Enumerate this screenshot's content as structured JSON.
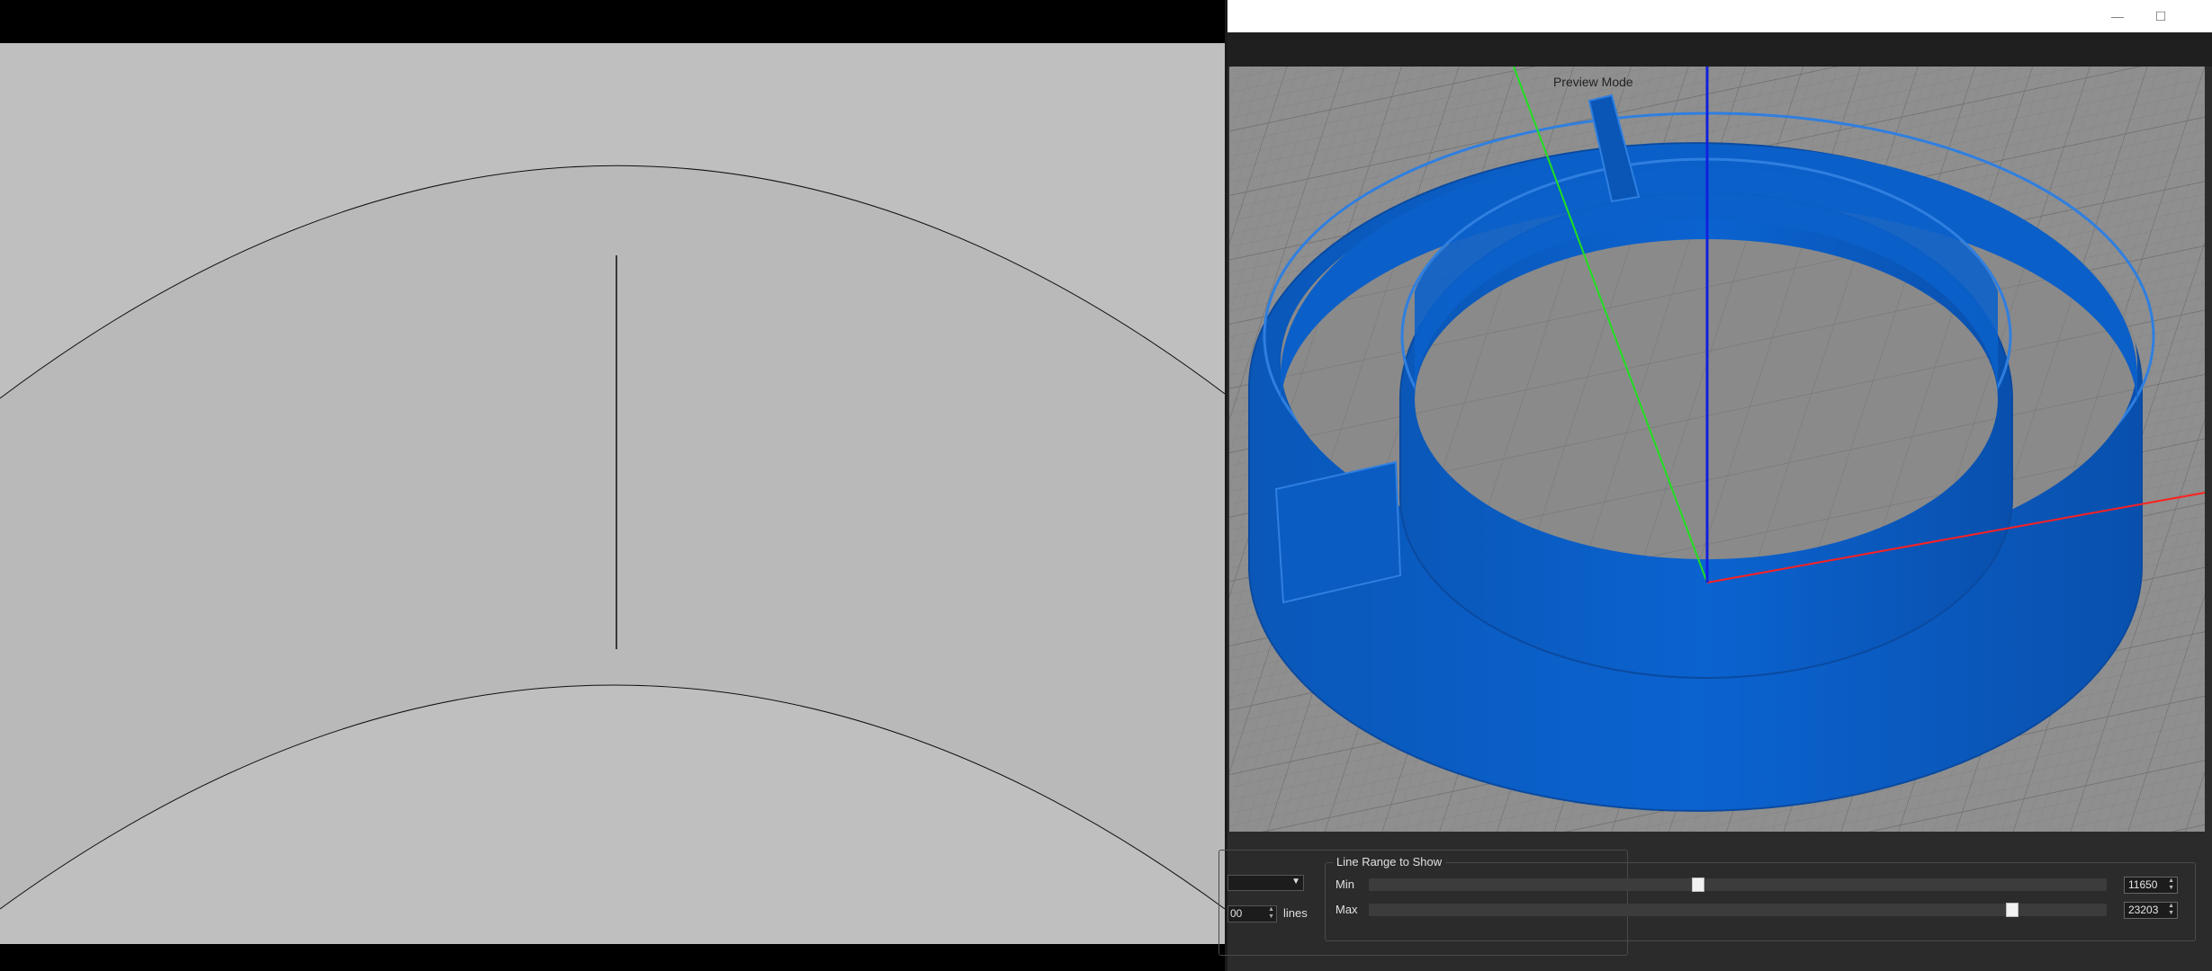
{
  "window": {
    "minimize_glyph": "—",
    "maximize_glyph": "☐"
  },
  "viewport": {
    "mode_label": "Preview Mode"
  },
  "left_controls": {
    "lines_value": "00",
    "lines_unit": "lines"
  },
  "line_range": {
    "title": "Line Range to Show",
    "min_label": "Min",
    "max_label": "Max",
    "min_value": "11650",
    "max_value": "23203",
    "min_fraction": 0.446,
    "max_fraction": 0.879
  },
  "colors": {
    "model": "#0a5fc7",
    "x_axis": "#ff2020",
    "y_axis": "#20e020",
    "z_axis": "#1020e0",
    "cad_background": "#bfbfbf"
  }
}
